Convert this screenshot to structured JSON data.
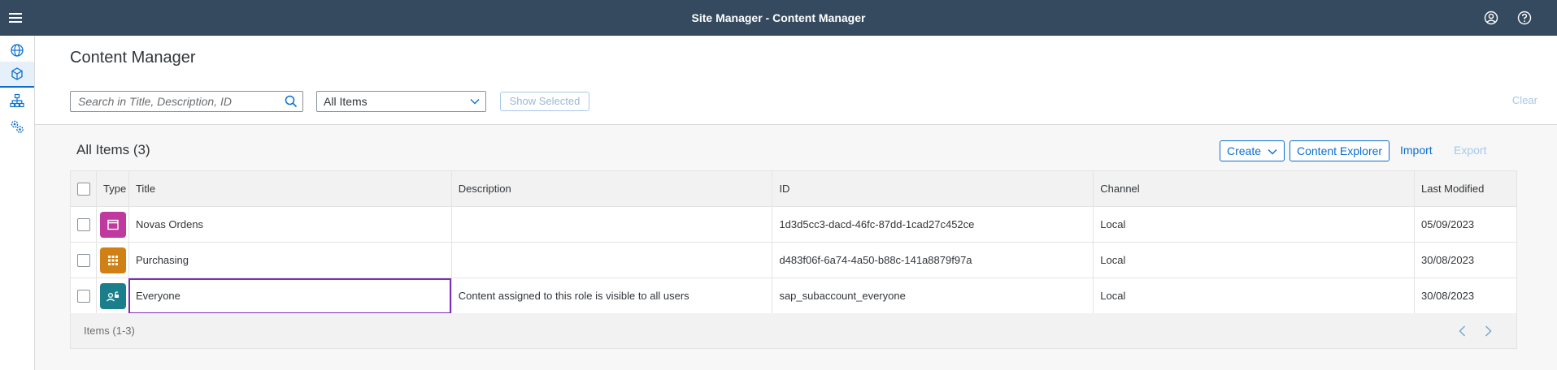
{
  "shell": {
    "title": "Site Manager - Content Manager",
    "icons": [
      "hamburger-menu-icon",
      "user-profile-icon",
      "help-icon"
    ]
  },
  "sidenav": {
    "items": [
      {
        "icon": "globe-icon",
        "active": false
      },
      {
        "icon": "content-cube-icon",
        "active": true
      },
      {
        "icon": "hierarchy-icon",
        "active": false
      },
      {
        "icon": "settings-gears-icon",
        "active": false
      }
    ]
  },
  "header": {
    "title": "Content Manager",
    "search_placeholder": "Search in Title, Description, ID",
    "filter_value": "All Items",
    "show_selected": "Show Selected",
    "clear": "Clear"
  },
  "table": {
    "title": "All Items (3)",
    "toolbar": {
      "create": "Create",
      "content_explorer": "Content Explorer",
      "import": "Import",
      "export": "Export"
    },
    "columns": [
      "Type",
      "Title",
      "Description",
      "ID",
      "Channel",
      "Last Modified"
    ],
    "rows": [
      {
        "type_icon": "app-window-icon",
        "color": "#c0399f",
        "title": "Novas Ordens",
        "description": "",
        "id": "1d3d5cc3-dacd-46fc-87dd-1cad27c452ce",
        "channel": "Local",
        "modified": "05/09/2023"
      },
      {
        "type_icon": "group-grid-icon",
        "color": "#d08014",
        "title": "Purchasing",
        "description": "",
        "id": "d483f06f-6a74-4a50-b88c-141a8879f97a",
        "channel": "Local",
        "modified": "30/08/2023"
      },
      {
        "type_icon": "role-unlocked-icon",
        "color": "#1a7f8a",
        "title": "Everyone",
        "description": "Content assigned to this role is visible to all users",
        "id": "sap_subaccount_everyone",
        "channel": "Local",
        "modified": "30/08/2023"
      }
    ],
    "footer": "Items (1-3)"
  },
  "colors": {
    "shell": "#354a5f",
    "accent": "#0a6ed1",
    "highlight": "#7b2fb5"
  }
}
